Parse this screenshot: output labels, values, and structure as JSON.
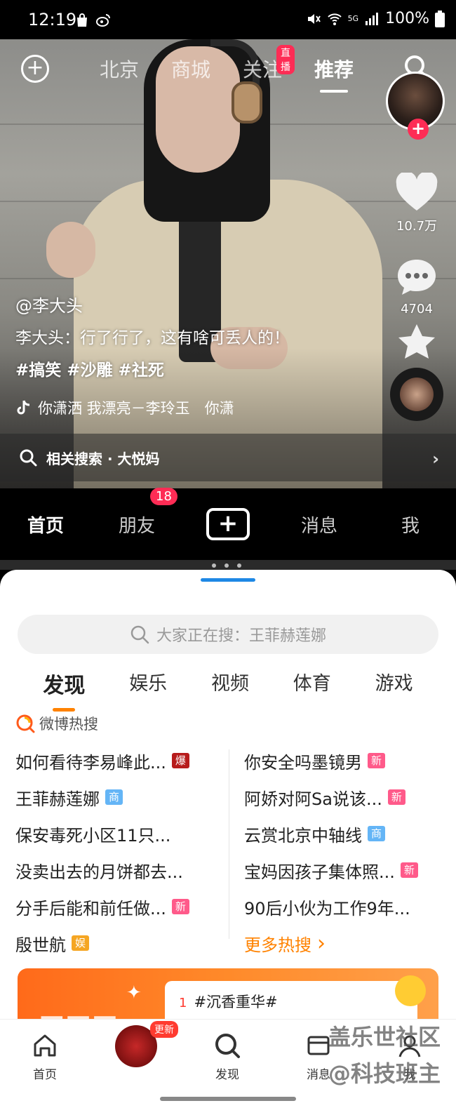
{
  "status_bar": {
    "time": "12:19",
    "network": "5G",
    "battery": "100%"
  },
  "video": {
    "top_tabs": [
      {
        "label": "北京",
        "active": false
      },
      {
        "label": "商城",
        "active": false
      },
      {
        "label": "关注",
        "active": false,
        "badge": "直播"
      },
      {
        "label": "推荐",
        "active": true
      }
    ],
    "likes": "10.7万",
    "comments": "4704",
    "author": "@李大头",
    "description": "李大头：行了行了，这有啥可丢人的！",
    "hashtags": "#搞笑 #沙雕 #社死",
    "music_text": "你潇洒 我漂亮－李玲玉　你潇",
    "related_search": "相关搜索 · 大悦妈"
  },
  "douyin_nav": {
    "items": [
      "首页",
      "朋友",
      "消息",
      "我"
    ],
    "friends_badge": "18"
  },
  "weibo": {
    "search_placeholder": "大家正在搜：王菲赫莲娜",
    "tabs": [
      {
        "label": "发现",
        "active": true
      },
      {
        "label": "娱乐",
        "active": false
      },
      {
        "label": "视频",
        "active": false
      },
      {
        "label": "体育",
        "active": false
      },
      {
        "label": "游戏",
        "active": false
      }
    ],
    "hot_title": "微博热搜",
    "hot_left": [
      {
        "text": "如何看待李易峰此...",
        "tag": "爆",
        "tag_type": "bao"
      },
      {
        "text": "王菲赫莲娜",
        "tag": "商",
        "tag_type": "shang"
      },
      {
        "text": "保安毒死小区11只...",
        "tag": "",
        "tag_type": ""
      },
      {
        "text": "没卖出去的月饼都去...",
        "tag": "",
        "tag_type": ""
      },
      {
        "text": "分手后能和前任做...",
        "tag": "新",
        "tag_type": "xin"
      },
      {
        "text": "殷世航",
        "tag": "娱",
        "tag_type": "yu"
      }
    ],
    "hot_right": [
      {
        "text": "你安全吗墨镜男",
        "tag": "新",
        "tag_type": "xin"
      },
      {
        "text": "阿娇对阿Sa说该...",
        "tag": "新",
        "tag_type": "xin"
      },
      {
        "text": "云赏北京中轴线",
        "tag": "商",
        "tag_type": "shang"
      },
      {
        "text": "宝妈因孩子集体照...",
        "tag": "新",
        "tag_type": "xin"
      },
      {
        "text": "90后小伙为工作9年...",
        "tag": "",
        "tag_type": ""
      }
    ],
    "more_hot": "更多热搜",
    "banner": {
      "rank": "1",
      "topic": "#沉香重华#"
    },
    "nav": {
      "home": "首页",
      "update_badge": "更新",
      "discover": "发现",
      "messages": "消息",
      "me": "我"
    },
    "watermark_1": "盖乐世社区",
    "watermark_2": "@科技班主"
  }
}
